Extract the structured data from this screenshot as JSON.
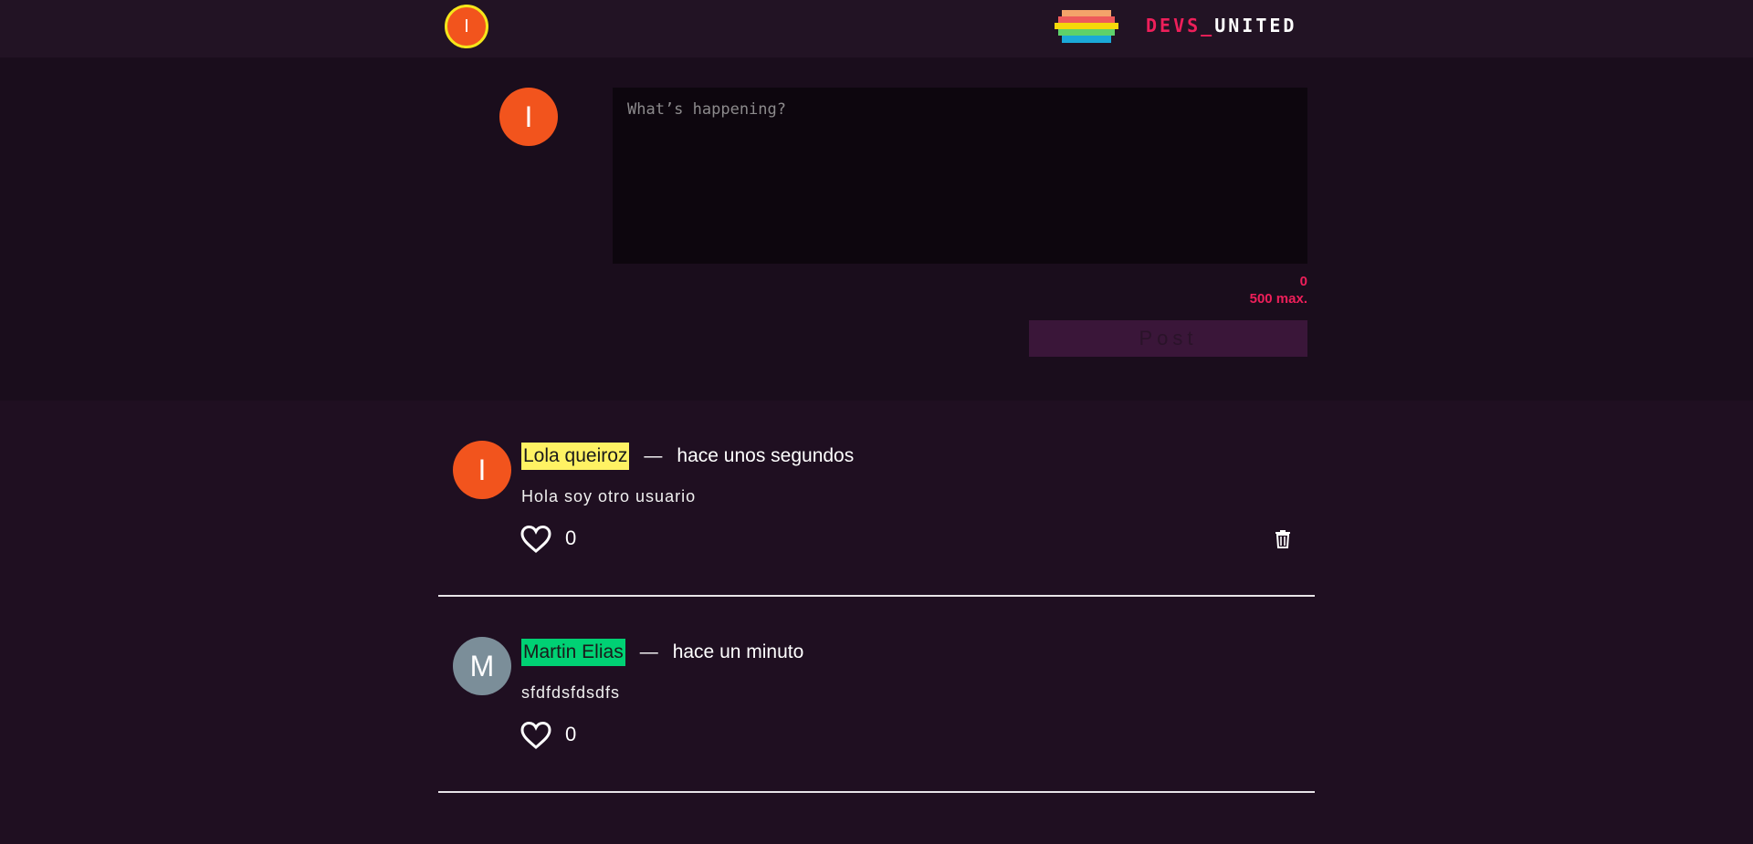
{
  "header": {
    "avatar_initial": "I",
    "logo": {
      "devs": "DEVS_",
      "united": "UNITED",
      "flag_colors": [
        "#f4a36a",
        "#ee5a5a",
        "#f5d90a",
        "#5ed16a",
        "#1aa9d8"
      ]
    }
  },
  "composer": {
    "avatar_initial": "I",
    "placeholder": "What’s happening?",
    "char_count": "0",
    "char_max": "500 max.",
    "post_label": "Post"
  },
  "posts": [
    {
      "avatar_initial": "I",
      "avatar_color": "#f2541d",
      "username": "Lola queiroz",
      "username_color": "#fff263",
      "separator": "—",
      "timestamp": "hace unos segundos",
      "text": "Hola soy otro usuario",
      "likes": "0",
      "deletable": true
    },
    {
      "avatar_initial": "M",
      "avatar_color": "#7b8e99",
      "username": "Martin Elias",
      "username_color": "#00d174",
      "separator": "—",
      "timestamp": "hace un minuto",
      "text": "sfdfdsfdsdfs",
      "likes": "0",
      "deletable": false
    }
  ],
  "colors": {
    "accent": "#ee1f5a",
    "orange_avatar": "#f2541d",
    "header_bg": "#221324",
    "composer_bg": "#1a0d1c",
    "feed_bg": "#1f0f21"
  }
}
